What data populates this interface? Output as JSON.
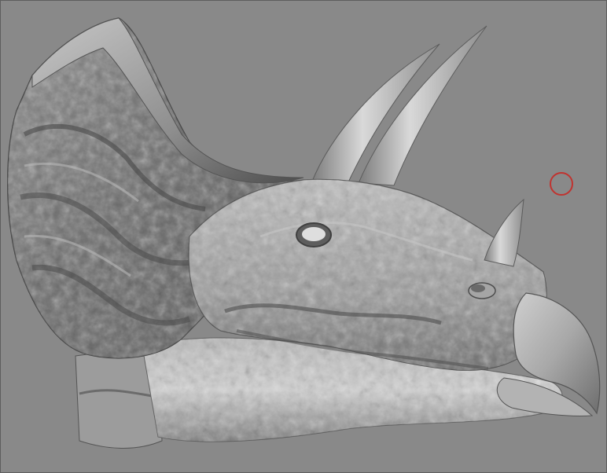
{
  "viewport": {
    "background_color": "#898989",
    "model": "triceratops-head-sculpt",
    "material_color": "#a9a9a9"
  },
  "brush_cursor": {
    "color": "#c0332f",
    "shape": "circle"
  }
}
